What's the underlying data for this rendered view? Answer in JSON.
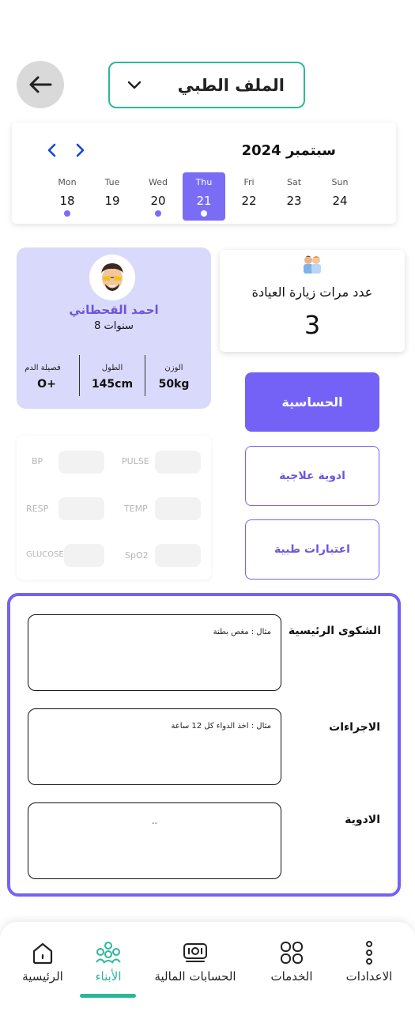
{
  "header": {
    "back_icon": "arrow-left-icon",
    "dropdown_label": "الملف الطبي",
    "dropdown_icon": "chevron-down-icon"
  },
  "calendar": {
    "month": "سبتمبر 2024",
    "prev_icon": "chevron-left-icon",
    "next_icon": "chevron-right-icon",
    "days": [
      {
        "name": "Mon",
        "num": "18",
        "dot": true,
        "active": false
      },
      {
        "name": "Tue",
        "num": "19",
        "dot": false,
        "active": false
      },
      {
        "name": "Wed",
        "num": "20",
        "dot": true,
        "active": false
      },
      {
        "name": "Thu",
        "num": "21",
        "dot": true,
        "active": true
      },
      {
        "name": "Fri",
        "num": "22",
        "dot": false,
        "active": false
      },
      {
        "name": "Sat",
        "num": "23",
        "dot": false,
        "active": false
      },
      {
        "name": "Sun",
        "num": "24",
        "dot": false,
        "active": false
      }
    ],
    "accent": "#7b6cf6"
  },
  "profile": {
    "name": "احمد القحطاني",
    "age": "8 سنوات",
    "stats": {
      "blood_label": "فصيلة الدم",
      "blood_value": "O+",
      "height_label": "الطول",
      "height_value": "145cm",
      "weight_label": "الوزن",
      "weight_value": "50kg"
    }
  },
  "visits": {
    "icon": "doctors-icon",
    "title": "عدد مرات زيارة العيادة",
    "count": "3"
  },
  "actions": {
    "allergy": "الحساسية",
    "medications": "ادوية علاجية",
    "tests": "اعتبارات طبية"
  },
  "vitals": {
    "bp": "BP",
    "pulse": "PULSE",
    "resp": "RESP",
    "temp": "TEMP",
    "glucose": "GLUCOSE",
    "spo2": "SpO2"
  },
  "notes": {
    "complaint_label": "الشكوى الرئيسية",
    "complaint_placeholder": "مثال : مغص بطنة",
    "procedures_label": "الاجراءات",
    "procedures_placeholder": "مثال : اخذ الدواء كل 12 ساعة",
    "medicine_label": "الادوية",
    "medicine_placeholder": "--"
  },
  "nav": {
    "home": "الرئيسية",
    "children": "الأبناء",
    "accounts": "الحسابات المالية",
    "services": "الخدمات",
    "settings": "الاعدادات",
    "active": "children",
    "active_color": "#2bb89a"
  },
  "colors": {
    "primary": "#7462f6",
    "teal": "#2bb89a",
    "profile_bg": "#d9d9fc"
  }
}
